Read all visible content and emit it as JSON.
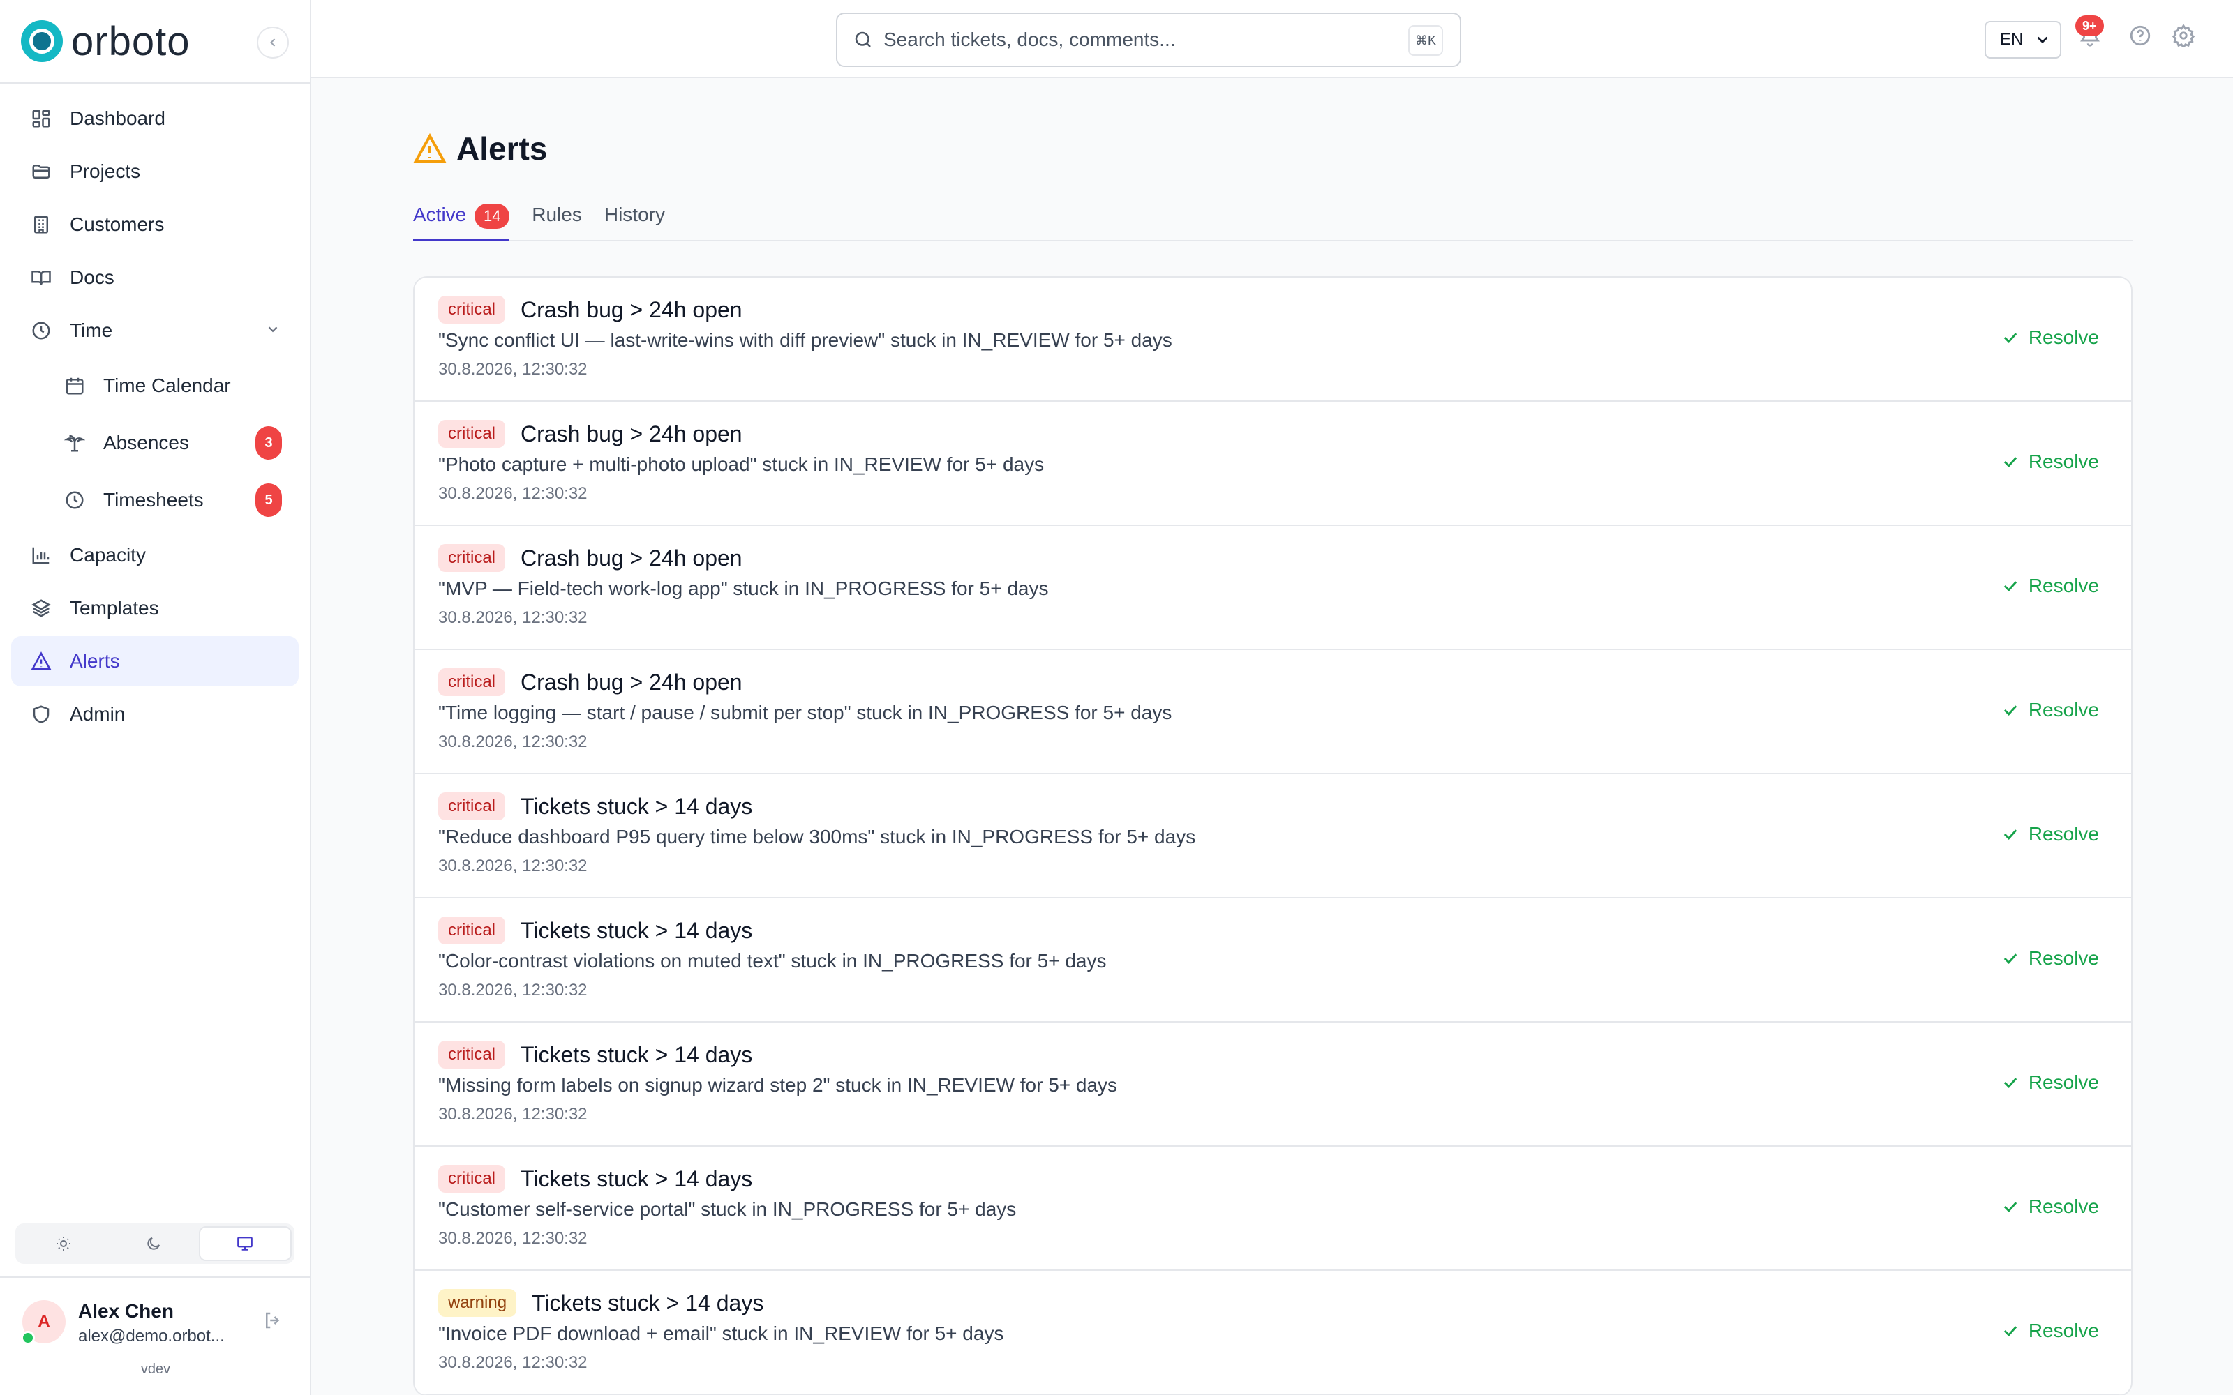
{
  "app": {
    "brand": "orboto"
  },
  "sidebar": {
    "items": [
      {
        "label": "Dashboard",
        "icon": "dashboard-icon"
      },
      {
        "label": "Projects",
        "icon": "folder-icon"
      },
      {
        "label": "Customers",
        "icon": "building-icon"
      },
      {
        "label": "Docs",
        "icon": "book-icon"
      },
      {
        "label": "Time",
        "icon": "clock-icon"
      },
      {
        "label": "Time Calendar",
        "icon": "calendar-icon"
      },
      {
        "label": "Absences",
        "icon": "palm-tree-icon",
        "badge": "3"
      },
      {
        "label": "Timesheets",
        "icon": "clock-icon",
        "badge": "5"
      },
      {
        "label": "Capacity",
        "icon": "bar-chart-icon"
      },
      {
        "label": "Templates",
        "icon": "layers-icon"
      },
      {
        "label": "Alerts",
        "icon": "warning-icon"
      },
      {
        "label": "Admin",
        "icon": "shield-icon"
      }
    ],
    "active": "Alerts",
    "theme_options": [
      "light",
      "dark",
      "system"
    ],
    "theme_selected": "system"
  },
  "user": {
    "initial": "A",
    "name": "Alex Chen",
    "email": "alex@demo.orbot...",
    "version": "vdev"
  },
  "topbar": {
    "search_placeholder": "Search tickets, docs, comments...",
    "search_shortcut": "⌘K",
    "language": "EN",
    "notifications_badge": "9+"
  },
  "page": {
    "title": "Alerts",
    "tabs": [
      {
        "label": "Active",
        "count": "14"
      },
      {
        "label": "Rules"
      },
      {
        "label": "History"
      }
    ]
  },
  "alerts": [
    {
      "severity": "critical",
      "title": "Crash bug > 24h open",
      "description": "\"Sync conflict UI — last-write-wins with diff preview\" stuck in IN_REVIEW for 5+ days",
      "time": "30.8.2026, 12:30:32",
      "action": "Resolve"
    },
    {
      "severity": "critical",
      "title": "Crash bug > 24h open",
      "description": "\"Photo capture + multi-photo upload\" stuck in IN_REVIEW for 5+ days",
      "time": "30.8.2026, 12:30:32",
      "action": "Resolve"
    },
    {
      "severity": "critical",
      "title": "Crash bug > 24h open",
      "description": "\"MVP — Field-tech work-log app\" stuck in IN_PROGRESS for 5+ days",
      "time": "30.8.2026, 12:30:32",
      "action": "Resolve"
    },
    {
      "severity": "critical",
      "title": "Crash bug > 24h open",
      "description": "\"Time logging — start / pause / submit per stop\" stuck in IN_PROGRESS for 5+ days",
      "time": "30.8.2026, 12:30:32",
      "action": "Resolve"
    },
    {
      "severity": "critical",
      "title": "Tickets stuck > 14 days",
      "description": "\"Reduce dashboard P95 query time below 300ms\" stuck in IN_PROGRESS for 5+ days",
      "time": "30.8.2026, 12:30:32",
      "action": "Resolve"
    },
    {
      "severity": "critical",
      "title": "Tickets stuck > 14 days",
      "description": "\"Color-contrast violations on muted text\" stuck in IN_PROGRESS for 5+ days",
      "time": "30.8.2026, 12:30:32",
      "action": "Resolve"
    },
    {
      "severity": "critical",
      "title": "Tickets stuck > 14 days",
      "description": "\"Missing form labels on signup wizard step 2\" stuck in IN_REVIEW for 5+ days",
      "time": "30.8.2026, 12:30:32",
      "action": "Resolve"
    },
    {
      "severity": "critical",
      "title": "Tickets stuck > 14 days",
      "description": "\"Customer self-service portal\" stuck in IN_PROGRESS for 5+ days",
      "time": "30.8.2026, 12:30:32",
      "action": "Resolve"
    },
    {
      "severity": "warning",
      "title": "Tickets stuck > 14 days",
      "description": "\"Invoice PDF download + email\" stuck in IN_REVIEW for 5+ days",
      "time": "30.8.2026, 12:30:32",
      "action": "Resolve"
    }
  ],
  "colors": {
    "accent": "#4338ca",
    "brand": "#14b8c4",
    "critical_bg": "#fee2e2",
    "critical_text": "#b91c1c",
    "warning_bg": "#fef3c7",
    "warning_text": "#92400e",
    "resolve": "#16a34a",
    "badge": "#ef4444"
  }
}
